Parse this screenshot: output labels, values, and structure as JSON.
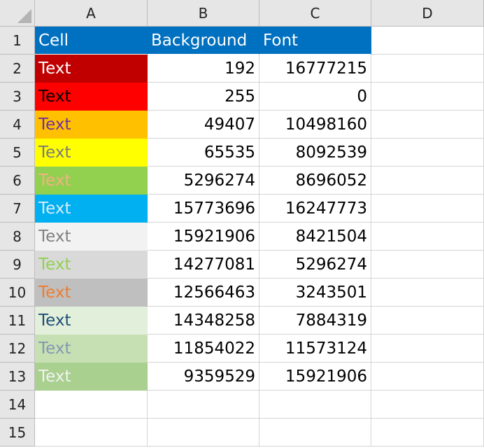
{
  "columns": [
    "A",
    "B",
    "C",
    "D"
  ],
  "row_numbers": [
    "1",
    "2",
    "3",
    "4",
    "5",
    "6",
    "7",
    "8",
    "9",
    "10",
    "11",
    "12",
    "13",
    "14",
    "15"
  ],
  "header": {
    "a": "Cell",
    "b": "Background",
    "c": "Font",
    "color": "#0070c0"
  },
  "rows": [
    {
      "a": "Text",
      "b": "192",
      "c": "16777215",
      "bg": "#c00000",
      "fg": "#ffffff"
    },
    {
      "a": "Text",
      "b": "255",
      "c": "0",
      "bg": "#ff0000",
      "fg": "#000000"
    },
    {
      "a": "Text",
      "b": "49407",
      "c": "10498160",
      "bg": "#ffc000",
      "fg": "#7030a0"
    },
    {
      "a": "Text",
      "b": "65535",
      "c": "8092539",
      "bg": "#ffff00",
      "fg": "#7b7b7b"
    },
    {
      "a": "Text",
      "b": "5296274",
      "c": "8696052",
      "bg": "#92d050",
      "fg": "#f4b084"
    },
    {
      "a": "Text",
      "b": "15773696",
      "c": "16247773",
      "bg": "#00b0f0",
      "fg": "#ddebf7"
    },
    {
      "a": "Text",
      "b": "15921906",
      "c": "8421504",
      "bg": "#f2f2f2",
      "fg": "#808080"
    },
    {
      "a": "Text",
      "b": "14277081",
      "c": "5296274",
      "bg": "#d9d9d9",
      "fg": "#92d050"
    },
    {
      "a": "Text",
      "b": "12566463",
      "c": "3243501",
      "bg": "#bfbfbf",
      "fg": "#ed7d31"
    },
    {
      "a": "Text",
      "b": "14348258",
      "c": "7884319",
      "bg": "#e2efda",
      "fg": "#1f4e78"
    },
    {
      "a": "Text",
      "b": "11854022",
      "c": "11573124",
      "bg": "#c6e0b4",
      "fg": "#8497b0"
    },
    {
      "a": "Text",
      "b": "9359529",
      "c": "15921906",
      "bg": "#a9d08e",
      "fg": "#f2f2f2"
    }
  ]
}
